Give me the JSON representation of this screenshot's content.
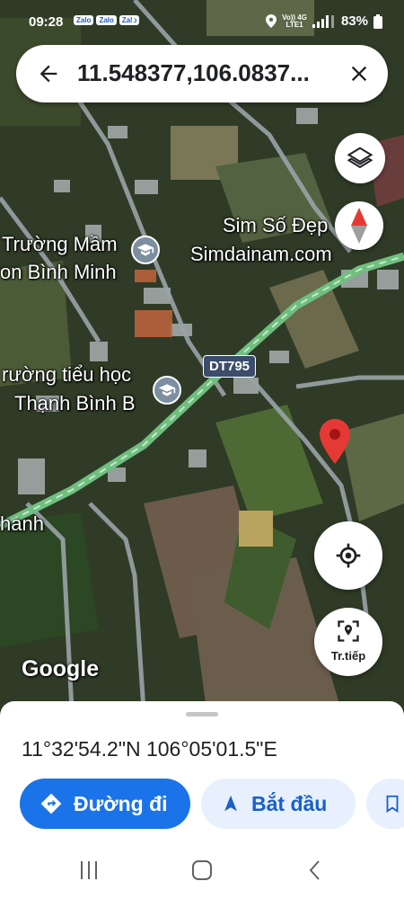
{
  "status_bar": {
    "time": "09:28",
    "apps": [
      "Zalo",
      "Zalo",
      "Zalo"
    ],
    "network_top": "Vo)) 4G",
    "network_bottom": "LTE1",
    "battery": "83%"
  },
  "search": {
    "query": "11.548377,106.0837..."
  },
  "map": {
    "labels": {
      "poi_business_line1": "Sim Số Đẹp",
      "poi_business_line2": "Simdainam.com",
      "school1_line1": "Trường Mầm",
      "school1_line2": "on Bình Minh",
      "school2_line1": "rường tiểu học",
      "school2_line2": "Thạnh Bình B",
      "road_partial": "hanh",
      "road_shield": "DT795",
      "attribution": "Google"
    },
    "recenter_label": "Tr.tiếp"
  },
  "place": {
    "coordinates": "11°32'54.2\"N 106°05'01.5\"E"
  },
  "actions": {
    "directions_label": "Đường đi",
    "start_label": "Bắt đầu"
  },
  "colors": {
    "accent": "#1a73e8",
    "pin": "#e53935"
  }
}
